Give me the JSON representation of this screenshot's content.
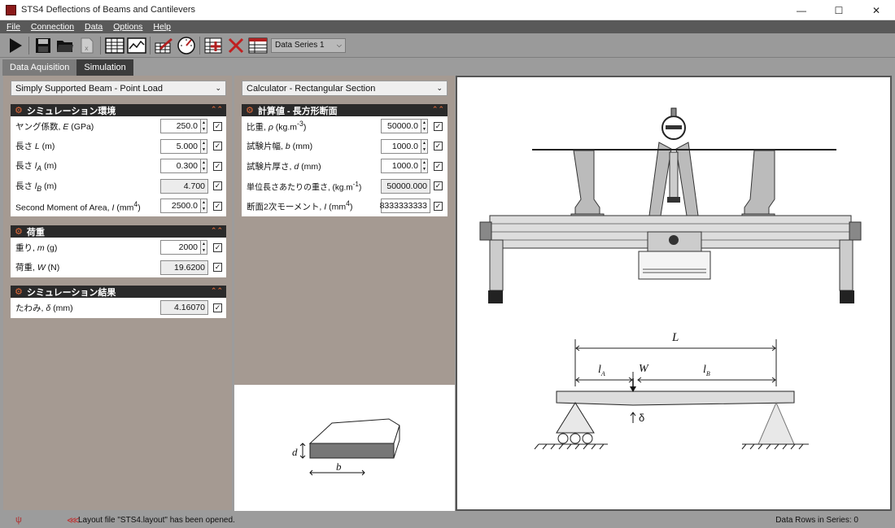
{
  "window": {
    "title": "STS4 Deflections of Beams and Cantilevers"
  },
  "menu": {
    "items": [
      "File",
      "Connection",
      "Data",
      "Options",
      "Help"
    ]
  },
  "toolbar": {
    "series_select": "Data Series 1"
  },
  "tabs": [
    {
      "label": "Data Aquisition",
      "active": false
    },
    {
      "label": "Simulation",
      "active": true
    }
  ],
  "left_panel": {
    "dropdown": "Simply Supported Beam - Point Load",
    "env": {
      "title": "シミュレーション環境",
      "rows": [
        {
          "label": "ヤング係数, E (GPa)",
          "value": "250.0"
        },
        {
          "label": "長さ L (m)",
          "value": "5.000"
        },
        {
          "label": "長さ lA (m)",
          "value": "0.300"
        },
        {
          "label": "長さ lB (m)",
          "value": "4.700"
        },
        {
          "label": "Second Moment of Area, I (mm4)",
          "value": "2500.0"
        }
      ]
    },
    "load": {
      "title": "荷重",
      "rows": [
        {
          "label": "重り, m (g)",
          "value": "2000"
        },
        {
          "label": "荷重, W (N)",
          "value": "19.6200"
        }
      ]
    },
    "result": {
      "title": "シミュレーション結果",
      "rows": [
        {
          "label": "たわみ, δ (mm)",
          "value": "4.16070"
        }
      ]
    }
  },
  "mid_panel": {
    "dropdown": "Calculator - Rectangular Section",
    "calc": {
      "title": "計算値 - 長方形断面",
      "rows": [
        {
          "label": "比重, ρ (kg.m-3)",
          "value": "50000.0"
        },
        {
          "label": "試験片幅, b (mm)",
          "value": "1000.0"
        },
        {
          "label": "試験片厚さ, d (mm)",
          "value": "1000.0"
        },
        {
          "label": "単位長さあたりの重さ, (kg.m-1)",
          "value": "50000.000"
        },
        {
          "label": "断面2次モーメント, I (mm4)",
          "value": "8333333333"
        }
      ]
    },
    "section_image": {
      "label_d": "d",
      "label_b": "b"
    }
  },
  "diagram": {
    "L": "L",
    "lA": "l",
    "lA_sub": "A",
    "lB": "l",
    "lB_sub": "B",
    "W": "W",
    "delta": "δ"
  },
  "status": {
    "message": "Layout file \"STS4.layout\" has been opened.",
    "rows": "Data Rows in Series: 0"
  }
}
